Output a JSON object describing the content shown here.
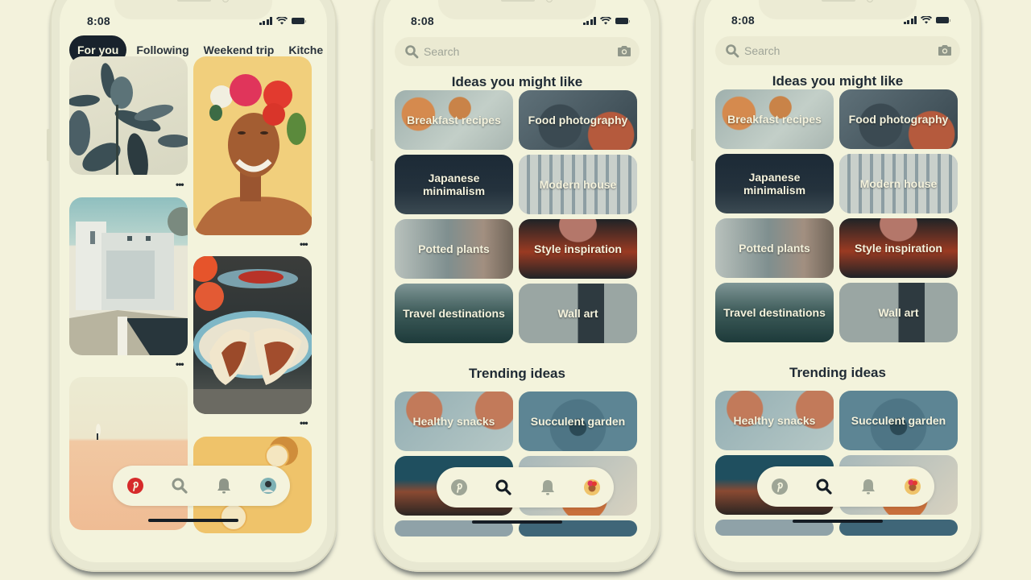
{
  "status_bar": {
    "time": "8:08"
  },
  "home_screen": {
    "tabs": [
      {
        "label": "For you",
        "active": true
      },
      {
        "label": "Following",
        "active": false
      },
      {
        "label": "Weekend trip",
        "active": false
      },
      {
        "label": "Kitche",
        "active": false
      }
    ],
    "pins": [
      {
        "subject": "rubber plant leaves",
        "more_label": "•••"
      },
      {
        "subject": "woman with flower crown",
        "more_label": "•••"
      },
      {
        "subject": "white modern building",
        "more_label": "•••"
      },
      {
        "subject": "tacos on plate",
        "more_label": "•••"
      },
      {
        "subject": "desert walker",
        "more_label": ""
      },
      {
        "subject": "lemon slices",
        "more_label": ""
      }
    ]
  },
  "search_screen": {
    "search": {
      "placeholder": "Search"
    },
    "ideas_title": "Ideas you might like",
    "ideas": [
      {
        "label": "Breakfast recipes"
      },
      {
        "label": "Food photography"
      },
      {
        "label": "Japanese minimalism"
      },
      {
        "label": "Modern house"
      },
      {
        "label": "Potted plants"
      },
      {
        "label": "Style inspiration"
      },
      {
        "label": "Travel destinations"
      },
      {
        "label": "Wall art"
      }
    ],
    "trending_title": "Trending ideas",
    "trending": [
      {
        "label": "Healthy snacks"
      },
      {
        "label": "Succulent garden"
      },
      {
        "label": ""
      },
      {
        "label": ""
      }
    ]
  },
  "nav": {
    "items": [
      "home-icon",
      "search-icon",
      "notifications-icon",
      "profile-avatar"
    ]
  },
  "colors": {
    "background": "#f3f2dc",
    "pinterest_red": "#d62a2a",
    "text_dark": "#1f2a34",
    "active_tab": "#18222c",
    "icon_gray": "#8f9689"
  }
}
